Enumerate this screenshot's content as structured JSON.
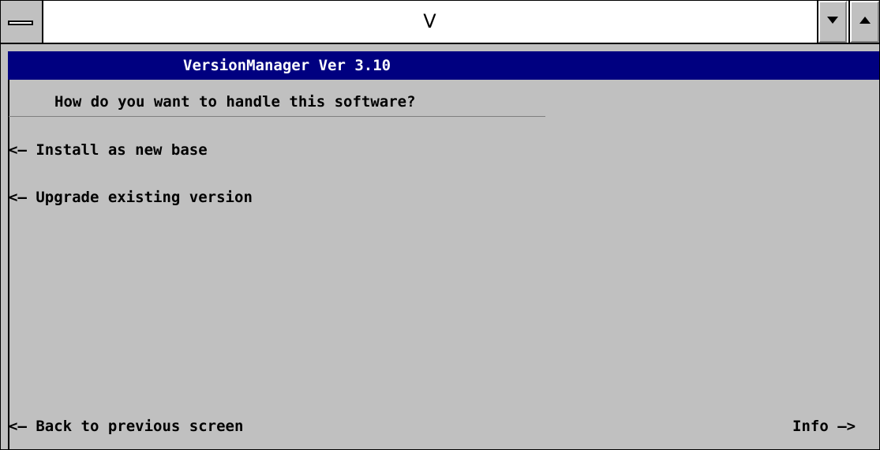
{
  "window": {
    "title": "V",
    "system_menu_icon": "system-menu-bar-icon",
    "minimize_icon": "triangle-down-icon",
    "maximize_icon": "triangle-up-icon"
  },
  "app": {
    "header": "VersionManager Ver 3.10",
    "question": "How do you want to handle this software?",
    "options": [
      {
        "arrow": "<—",
        "label": "Install as new base"
      },
      {
        "arrow": "<—",
        "label": "Upgrade existing version"
      }
    ],
    "footer": {
      "back": {
        "arrow": "<—",
        "label": "Back to previous screen"
      },
      "info": {
        "label": "Info",
        "arrow": "—>"
      }
    }
  },
  "colors": {
    "background": "#c0c0c0",
    "header_bg": "#000080",
    "header_text": "#ffffff"
  }
}
